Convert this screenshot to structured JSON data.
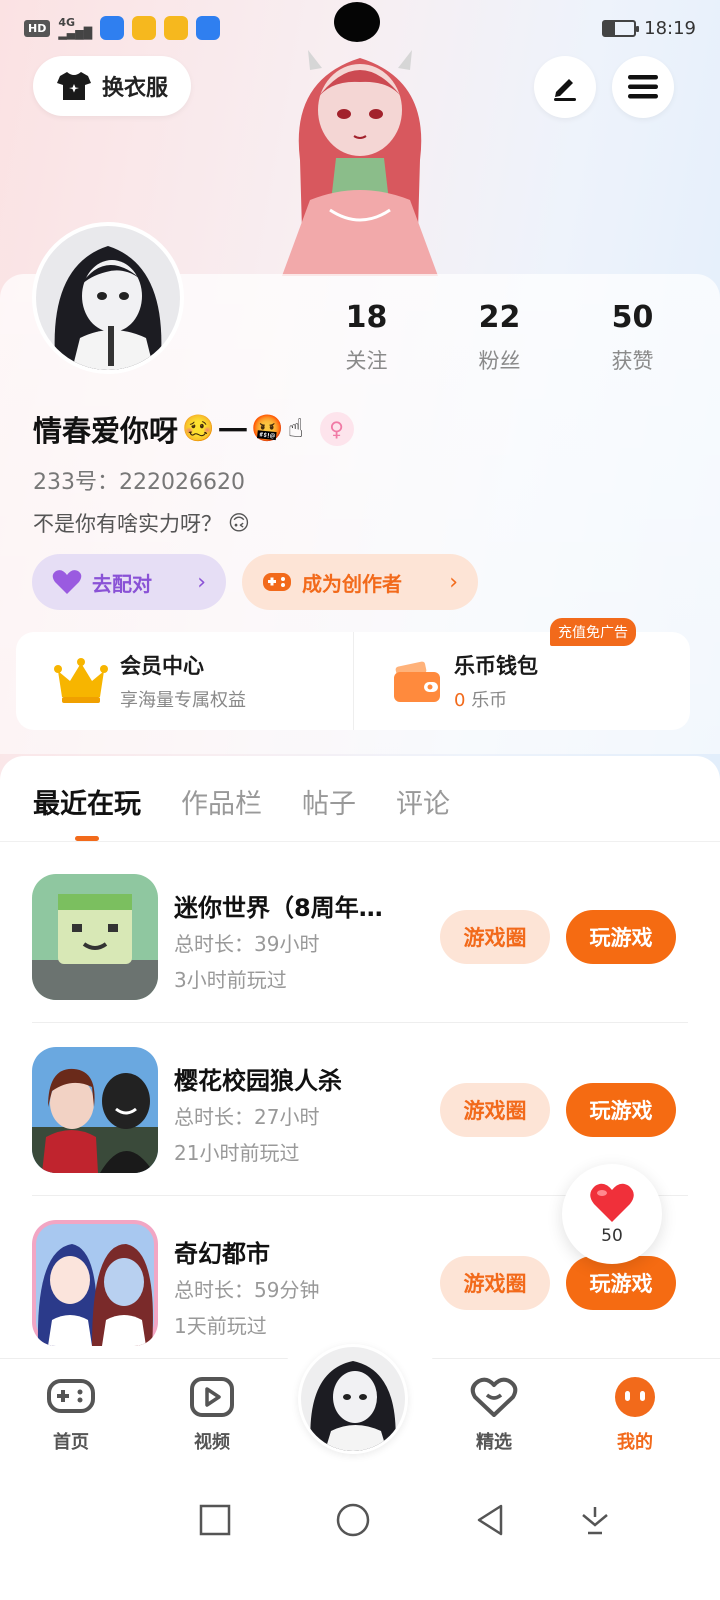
{
  "status_bar": {
    "hd": "HD",
    "network": "4G",
    "time": "18:19",
    "battery_level": 0.35
  },
  "header": {
    "outfit_label": "换衣服",
    "edit_icon": "pen-icon",
    "menu_icon": "hamburger-menu-icon"
  },
  "profile": {
    "stats": [
      {
        "value": "18",
        "label": "关注"
      },
      {
        "value": "22",
        "label": "粉丝"
      },
      {
        "value": "50",
        "label": "获赞"
      }
    ],
    "nickname": "情春爱你呀",
    "nickname_emoji_1": "🥴",
    "nickname_dash": "一",
    "nickname_emoji_2": "🤬",
    "nickname_emoji_3": "☝",
    "gender_symbol": "♀",
    "user_id": "233号：222026620",
    "bio": "不是你有啥实力呀？",
    "bio_emoji": "🙃",
    "match_label": "去配对",
    "creator_label": "成为创作者",
    "chevron": "›"
  },
  "member": {
    "title": "会员中心",
    "subtitle": "享海量专属权益"
  },
  "wallet": {
    "title": "乐币钱包",
    "coin_value": "0",
    "coin_unit": "乐币",
    "promo": "充值免广告"
  },
  "tabs": [
    {
      "label": "最近在玩",
      "active": true
    },
    {
      "label": "作品栏",
      "active": false
    },
    {
      "label": "帖子",
      "active": false
    },
    {
      "label": "评论",
      "active": false
    }
  ],
  "games": [
    {
      "name": "迷你世界（8周年…",
      "time": "总时长：39小时",
      "last": "3小时前玩过",
      "circle_label": "游戏圈",
      "play_label": "玩游戏"
    },
    {
      "name": "樱花校园狼人杀",
      "time": "总时长：27小时",
      "last": "21小时前玩过",
      "circle_label": "游戏圈",
      "play_label": "玩游戏"
    },
    {
      "name": "奇幻都市",
      "time": "总时长：59分钟",
      "last": "1天前玩过",
      "circle_label": "游戏圈",
      "play_label": "玩游戏"
    }
  ],
  "like_bubble": {
    "count": "50"
  },
  "bottom_nav": [
    {
      "label": "首页",
      "icon": "gamepad-icon"
    },
    {
      "label": "视频",
      "icon": "video-play-icon"
    },
    {
      "label": "精选",
      "icon": "heart-chat-icon"
    },
    {
      "label": "我的",
      "icon": "face-icon"
    }
  ],
  "colors": {
    "accent": "#f26a1b",
    "match_purple": "#8a52d6"
  }
}
